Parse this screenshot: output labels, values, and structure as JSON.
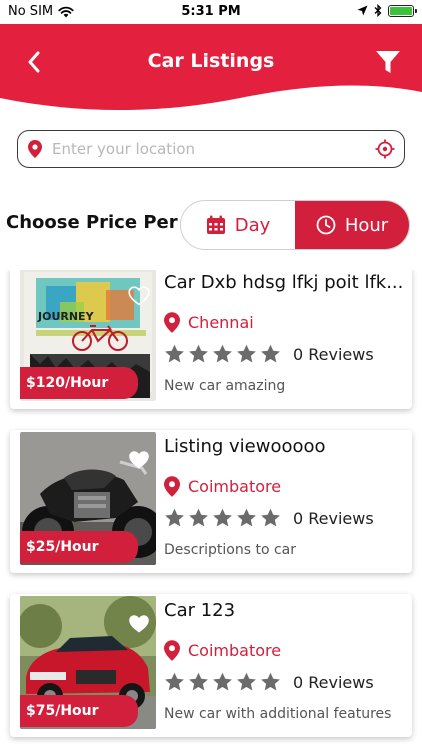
{
  "status_bar": {
    "carrier": "No SIM",
    "time": "5:31 PM",
    "battery_color": "#3bc43b"
  },
  "header": {
    "title": "Car Listings",
    "back_icon": "chevron-left-icon",
    "filter_icon": "filter-funnel-icon",
    "background_color": "#e3203e"
  },
  "location": {
    "placeholder": "Enter your location",
    "value": "",
    "pin_icon": "map-pin-icon",
    "target_icon": "crosshair-target-icon"
  },
  "price_per": {
    "label": "Choose Price Per",
    "options": [
      {
        "label": "Day",
        "icon": "calendar-icon",
        "selected": false
      },
      {
        "label": "Hour",
        "icon": "clock-icon",
        "selected": true
      }
    ]
  },
  "listings": [
    {
      "title": "Car Dxb hdsg lfkj poit lfk...",
      "location": "Chennai",
      "rating": 0,
      "reviews": "0 Reviews",
      "description": "New car amazing",
      "price": "$120/Hour",
      "image": "journey-bicycle-painting"
    },
    {
      "title": "Listing viewooooo",
      "location": "Coimbatore",
      "rating": 0,
      "reviews": "0 Reviews",
      "description": "Descriptions to car",
      "price": "$25/Hour",
      "image": "black-motorcycle"
    },
    {
      "title": "Car 123",
      "location": "Coimbatore",
      "rating": 0,
      "reviews": "0 Reviews",
      "description": "New car with additional features",
      "price": "$75/Hour",
      "image": "red-suv"
    }
  ],
  "colors": {
    "accent": "#d21f3c",
    "star": "#6b6b6b"
  }
}
